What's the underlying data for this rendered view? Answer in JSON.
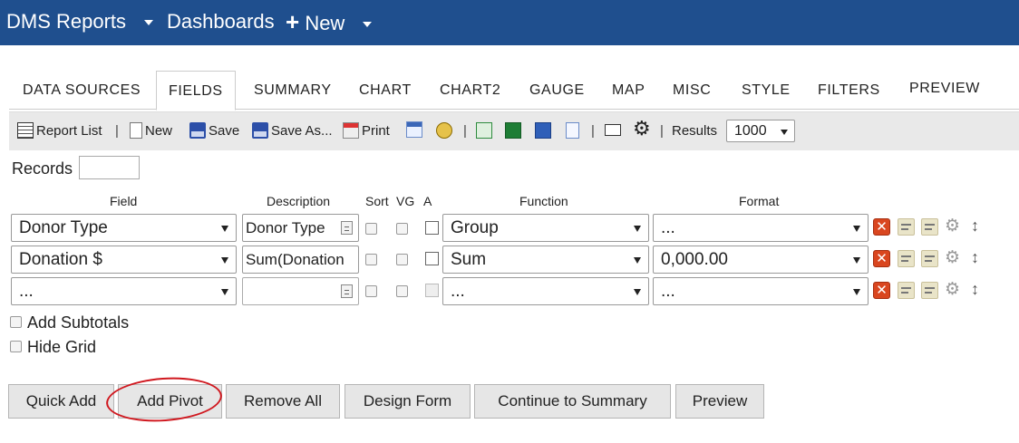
{
  "topnav": {
    "app_title": "DMS Reports",
    "dashboards": "Dashboards",
    "new_label": "New"
  },
  "tabs": [
    "DATA SOURCES",
    "FIELDS",
    "SUMMARY",
    "CHART",
    "CHART2",
    "GAUGE",
    "MAP",
    "MISC",
    "STYLE",
    "FILTERS",
    "PREVIEW"
  ],
  "active_tab": "FIELDS",
  "toolbar": {
    "report_list": "Report List",
    "new": "New",
    "save": "Save",
    "save_as": "Save As...",
    "print": "Print",
    "results_label": "Results",
    "results_value": "1000"
  },
  "records": {
    "label": "Records",
    "value": ""
  },
  "columns": {
    "field": "Field",
    "description": "Description",
    "sort": "Sort",
    "vg": "VG",
    "a": "A",
    "function": "Function",
    "format": "Format"
  },
  "rows": [
    {
      "field": "Donor Type",
      "description": "Donor Type",
      "function": "Group",
      "format": "..."
    },
    {
      "field": "Donation $",
      "description": "Sum(Donation",
      "function": "Sum",
      "format": "0,000.00"
    },
    {
      "field": "...",
      "description": "",
      "function": "...",
      "format": "..."
    }
  ],
  "options": {
    "add_subtotals": "Add Subtotals",
    "hide_grid": "Hide Grid"
  },
  "buttons": {
    "quick_add": "Quick Add",
    "add_pivot": "Add Pivot",
    "remove_all": "Remove All",
    "design_form": "Design Form",
    "continue_summary": "Continue to Summary",
    "preview": "Preview"
  },
  "colors": {
    "topbar": "#1f4f8e",
    "highlight_circle": "#d0181f",
    "delete_icon": "#d9461f"
  }
}
